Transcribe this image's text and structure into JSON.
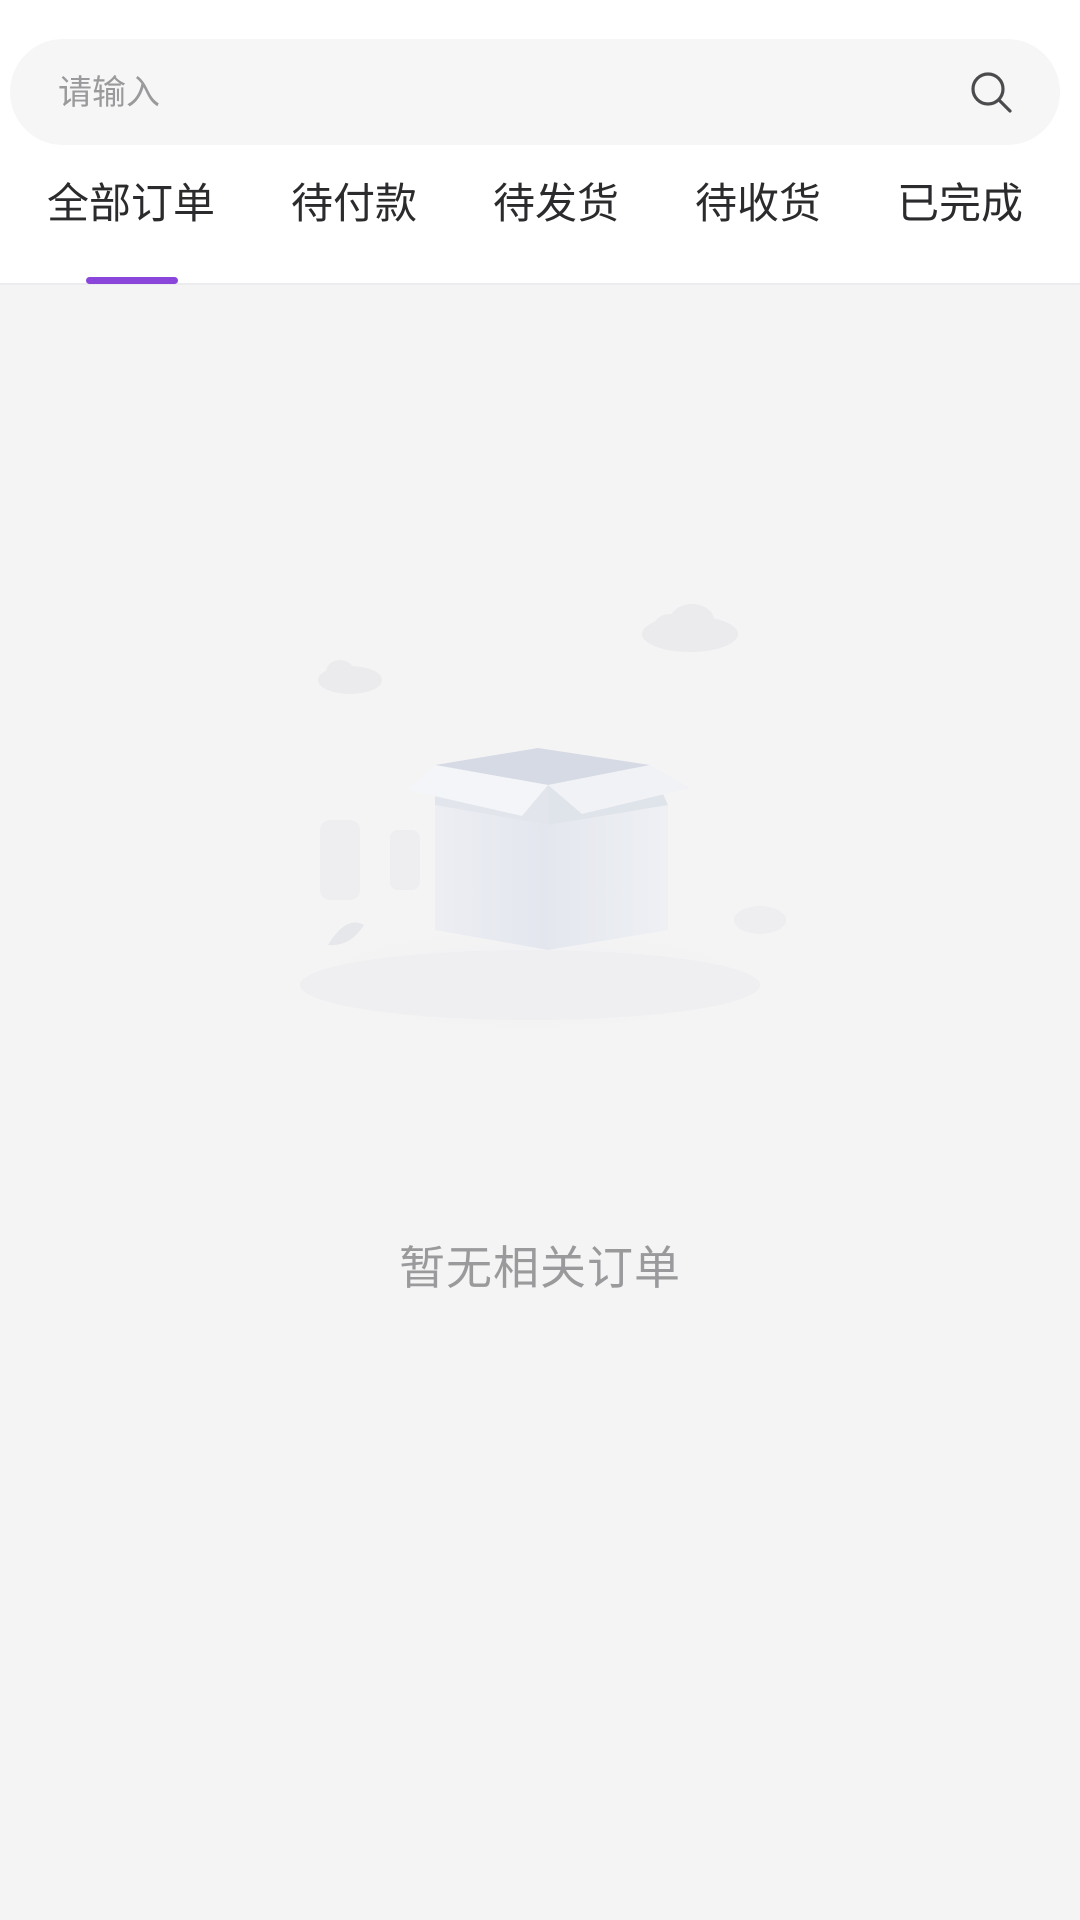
{
  "search": {
    "placeholder": "请输入",
    "icon": "search-icon"
  },
  "tabs": [
    {
      "label": "全部订单",
      "active": true
    },
    {
      "label": "待付款",
      "active": false
    },
    {
      "label": "待发货",
      "active": false
    },
    {
      "label": "待收货",
      "active": false
    },
    {
      "label": "已完成",
      "active": false
    }
  ],
  "colors": {
    "accent": "#8a46db",
    "background": "#f4f4f5",
    "text": "#2b2b2e",
    "muted": "#9a9a9c"
  },
  "empty_state": {
    "text": "暂无相关订单",
    "illustration": "empty-box-illustration"
  }
}
